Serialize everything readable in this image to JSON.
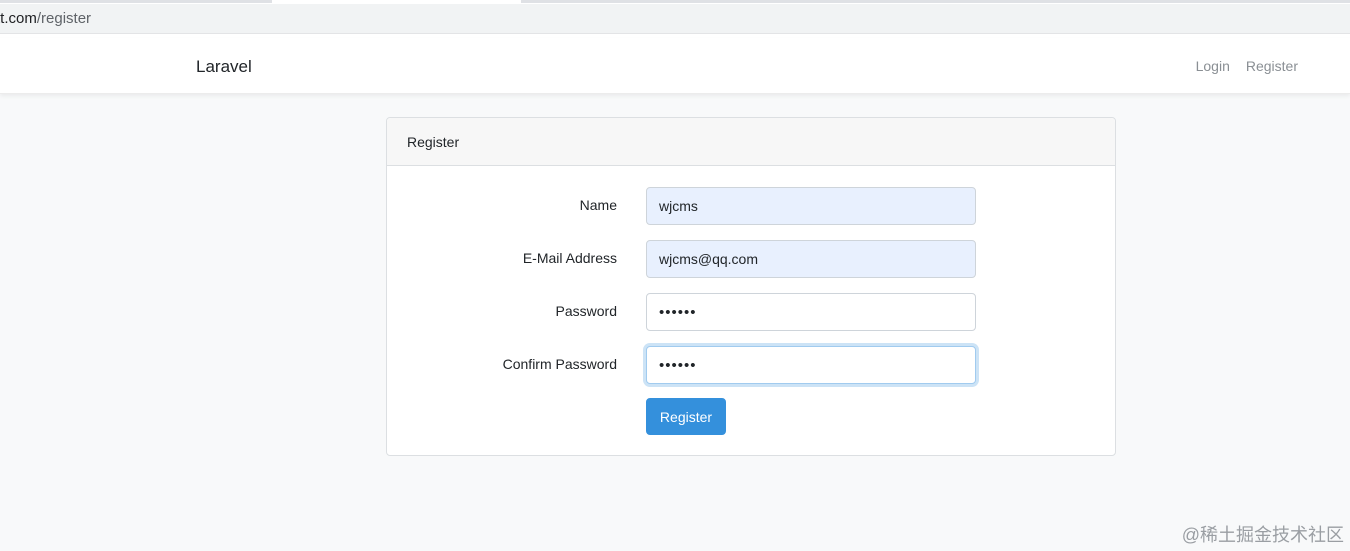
{
  "browser": {
    "url_host": "tt.com",
    "url_path": "/register"
  },
  "navbar": {
    "brand": "Laravel",
    "links": [
      "Login",
      "Register"
    ]
  },
  "card": {
    "title": "Register",
    "fields": [
      {
        "label": "Name",
        "value": "wjcms",
        "type": "text"
      },
      {
        "label": "E-Mail Address",
        "value": "wjcms@qq.com",
        "type": "email"
      },
      {
        "label": "Password",
        "value": "••••••",
        "type": "password"
      },
      {
        "label": "Confirm Password",
        "value": "••••••",
        "type": "password"
      }
    ],
    "submit_label": "Register"
  },
  "watermark": "@稀土掘金技术社区",
  "colors": {
    "primary": "#3490dc",
    "page_bg": "#f8f9fa",
    "autofill_bg": "#e8f0fe"
  }
}
